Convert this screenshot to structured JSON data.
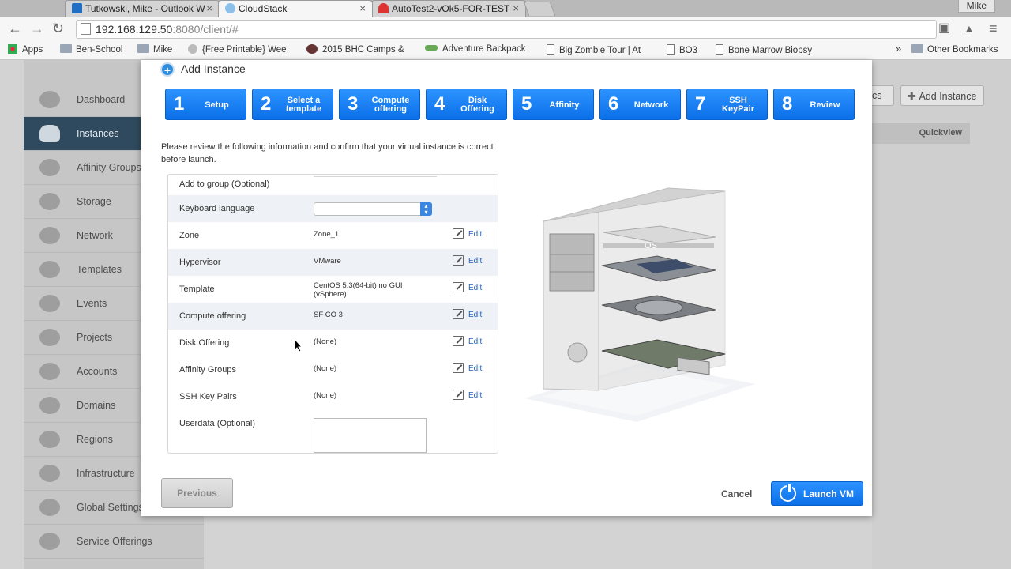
{
  "browser": {
    "tabs": [
      {
        "title": "Tutkowski, Mike - Outlook W"
      },
      {
        "title": "CloudStack"
      },
      {
        "title": "AutoTest2-vOk5-FOR-TEST"
      }
    ],
    "user": "Mike",
    "url_host": "192.168.129.50",
    "url_rest": ":8080/client/#",
    "bookmarks": [
      {
        "label": "Apps"
      },
      {
        "label": "Ben-School"
      },
      {
        "label": "Mike"
      },
      {
        "label": "{Free Printable} Wee"
      },
      {
        "label": "2015 BHC Camps &"
      },
      {
        "label": "Adventure Backpack"
      },
      {
        "label": "Big Zombie Tour | At"
      },
      {
        "label": "BO3"
      },
      {
        "label": "Bone Marrow Biopsy"
      },
      {
        "label": "»"
      },
      {
        "label": "Other Bookmarks"
      }
    ]
  },
  "sidebar": {
    "items": [
      {
        "label": "Dashboard",
        "icon": "dashboard-icon"
      },
      {
        "label": "Instances",
        "icon": "cloud-icon"
      },
      {
        "label": "Affinity Groups",
        "icon": "affinity-icon"
      },
      {
        "label": "Storage",
        "icon": "storage-icon"
      },
      {
        "label": "Network",
        "icon": "network-icon"
      },
      {
        "label": "Templates",
        "icon": "templates-icon"
      },
      {
        "label": "Events",
        "icon": "events-icon"
      },
      {
        "label": "Projects",
        "icon": "projects-icon"
      },
      {
        "label": "Accounts",
        "icon": "accounts-icon"
      },
      {
        "label": "Domains",
        "icon": "domains-icon"
      },
      {
        "label": "Regions",
        "icon": "regions-icon"
      },
      {
        "label": "Infrastructure",
        "icon": "infrastructure-icon"
      },
      {
        "label": "Global Settings",
        "icon": "settings-icon"
      },
      {
        "label": "Service Offerings",
        "icon": "gear-icon"
      }
    ]
  },
  "right": {
    "metrics_label": "rics",
    "add_instance_label": "Add Instance",
    "quickview_header": "Quickview"
  },
  "dialog": {
    "title": "Add Instance",
    "steps": [
      {
        "num": "1",
        "label": "Setup"
      },
      {
        "num": "2",
        "label": "Select a template"
      },
      {
        "num": "3",
        "label": "Compute offering"
      },
      {
        "num": "4",
        "label": "Disk Offering"
      },
      {
        "num": "5",
        "label": "Affinity"
      },
      {
        "num": "6",
        "label": "Network"
      },
      {
        "num": "7",
        "label": "SSH KeyPair"
      },
      {
        "num": "8",
        "label": "Review"
      }
    ],
    "intro": "Please review the following information and confirm that your virtual instance is correct before launch.",
    "rows": [
      {
        "label": "Add to group (Optional)",
        "value": ""
      },
      {
        "label": "Keyboard language",
        "value": ""
      },
      {
        "label": "Zone",
        "value": "Zone_1",
        "edit": "Edit"
      },
      {
        "label": "Hypervisor",
        "value": "VMware",
        "edit": "Edit"
      },
      {
        "label": "Template",
        "value": "CentOS 5.3(64-bit) no GUI (vSphere)",
        "edit": "Edit"
      },
      {
        "label": "Compute offering",
        "value": "SF CO 3",
        "edit": "Edit"
      },
      {
        "label": "Disk Offering",
        "value": "(None)",
        "edit": "Edit"
      },
      {
        "label": "Affinity Groups",
        "value": "(None)",
        "edit": "Edit"
      },
      {
        "label": "SSH Key Pairs",
        "value": "(None)",
        "edit": "Edit"
      },
      {
        "label": "Userdata (Optional)",
        "value": ""
      }
    ],
    "os_label": "OS",
    "previous_label": "Previous",
    "cancel_label": "Cancel",
    "launch_label": "Launch VM"
  }
}
